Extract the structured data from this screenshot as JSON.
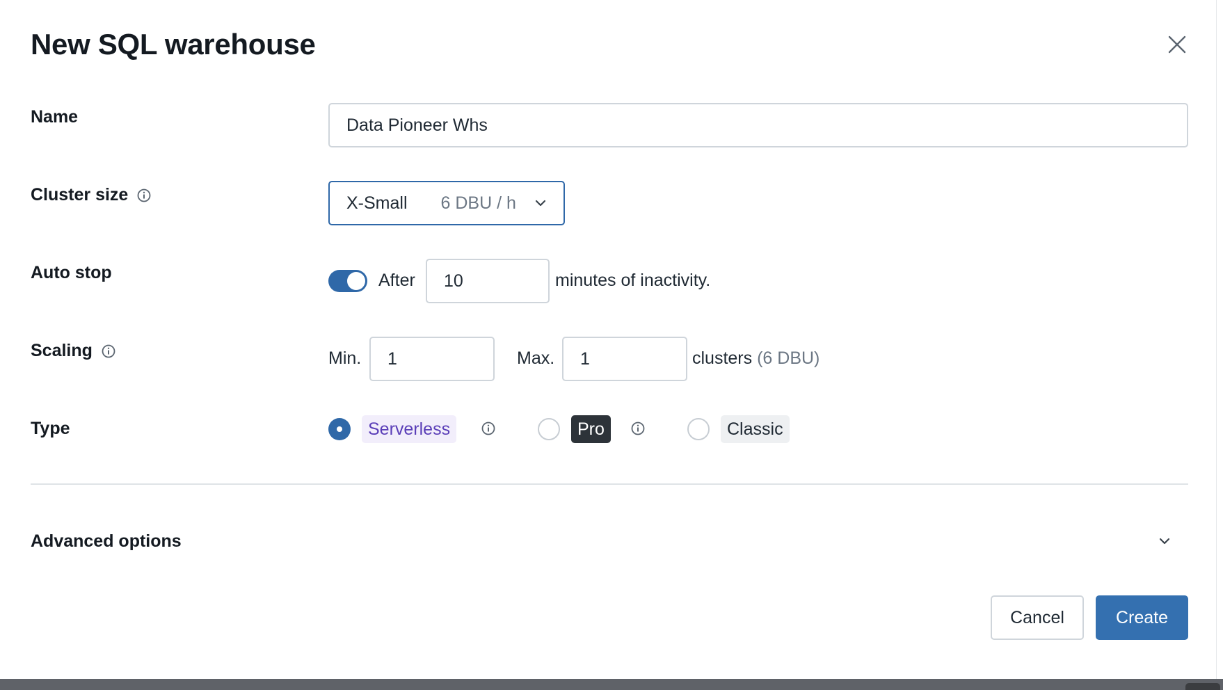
{
  "dialog": {
    "title": "New SQL warehouse"
  },
  "form": {
    "name": {
      "label": "Name",
      "value": "Data Pioneer Whs"
    },
    "cluster_size": {
      "label": "Cluster size",
      "value": "X-Small",
      "detail": "6 DBU / h"
    },
    "auto_stop": {
      "label": "Auto stop",
      "enabled": true,
      "prefix": "After",
      "value": "10",
      "suffix": "minutes of inactivity."
    },
    "scaling": {
      "label": "Scaling",
      "min_label": "Min.",
      "min_value": "1",
      "max_label": "Max.",
      "max_value": "1",
      "suffix": "clusters",
      "suffix_detail": "(6 DBU)"
    },
    "type": {
      "label": "Type",
      "options": [
        {
          "label": "Serverless",
          "selected": true
        },
        {
          "label": "Pro",
          "selected": false
        },
        {
          "label": "Classic",
          "selected": false
        }
      ]
    }
  },
  "advanced": {
    "label": "Advanced options"
  },
  "footer": {
    "cancel_label": "Cancel",
    "create_label": "Create"
  },
  "colors": {
    "accent": "#3470b0",
    "serverless_tag_bg": "#f2eefb",
    "serverless_tag_text": "#5b3fb8",
    "pro_tag_bg": "#2d3339"
  },
  "icons": {
    "close": "close-icon",
    "info": "info-icon",
    "chevron": "chevron-down-icon"
  }
}
